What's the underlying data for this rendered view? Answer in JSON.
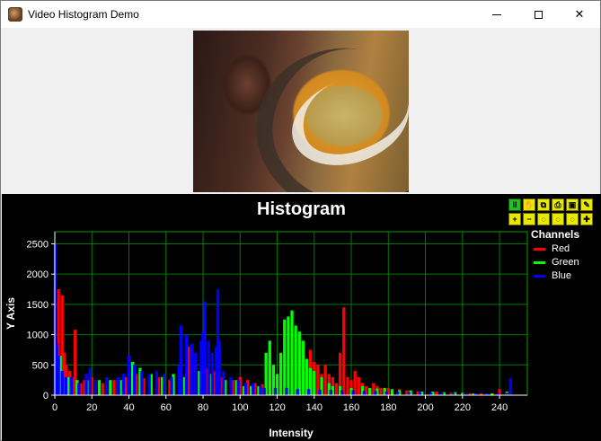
{
  "window": {
    "title": "Video Histogram Demo"
  },
  "chart_data": {
    "type": "bar",
    "title": "Histogram",
    "xlabel": "Intensity",
    "ylabel": "Y Axis",
    "xlim": [
      0,
      255
    ],
    "ylim": [
      0,
      2700
    ],
    "xticks": [
      0,
      20,
      40,
      60,
      80,
      100,
      120,
      140,
      160,
      180,
      200,
      220,
      240
    ],
    "yticks": [
      0,
      500,
      1000,
      1500,
      2000,
      2500
    ],
    "grid": true,
    "legend_title": "Channels",
    "legend_position": "right",
    "series": [
      {
        "name": "Red",
        "color": "#ff0000",
        "points": [
          [
            2,
            1750
          ],
          [
            4,
            1650
          ],
          [
            5,
            700
          ],
          [
            6,
            500
          ],
          [
            8,
            400
          ],
          [
            10,
            300
          ],
          [
            11,
            1080
          ],
          [
            14,
            200
          ],
          [
            16,
            250
          ],
          [
            20,
            300
          ],
          [
            26,
            200
          ],
          [
            32,
            250
          ],
          [
            38,
            300
          ],
          [
            44,
            350
          ],
          [
            48,
            280
          ],
          [
            56,
            300
          ],
          [
            62,
            250
          ],
          [
            68,
            600
          ],
          [
            72,
            800
          ],
          [
            74,
            700
          ],
          [
            76,
            500
          ],
          [
            82,
            450
          ],
          [
            86,
            400
          ],
          [
            90,
            300
          ],
          [
            96,
            250
          ],
          [
            100,
            300
          ],
          [
            104,
            250
          ],
          [
            108,
            200
          ],
          [
            112,
            180
          ],
          [
            116,
            200
          ],
          [
            120,
            150
          ],
          [
            132,
            250
          ],
          [
            134,
            800
          ],
          [
            136,
            600
          ],
          [
            138,
            750
          ],
          [
            140,
            550
          ],
          [
            142,
            500
          ],
          [
            144,
            350
          ],
          [
            146,
            500
          ],
          [
            148,
            350
          ],
          [
            150,
            300
          ],
          [
            152,
            200
          ],
          [
            154,
            700
          ],
          [
            156,
            1450
          ],
          [
            158,
            300
          ],
          [
            160,
            250
          ],
          [
            162,
            400
          ],
          [
            164,
            300
          ],
          [
            166,
            200
          ],
          [
            168,
            150
          ],
          [
            170,
            120
          ],
          [
            172,
            200
          ],
          [
            174,
            150
          ],
          [
            176,
            120
          ],
          [
            178,
            100
          ],
          [
            180,
            120
          ],
          [
            186,
            100
          ],
          [
            190,
            80
          ],
          [
            196,
            60
          ],
          [
            206,
            60
          ],
          [
            214,
            40
          ],
          [
            224,
            30
          ],
          [
            230,
            30
          ],
          [
            240,
            100
          ],
          [
            244,
            40
          ]
        ]
      },
      {
        "name": "Green",
        "color": "#00ff00",
        "points": [
          [
            3,
            650
          ],
          [
            7,
            300
          ],
          [
            12,
            250
          ],
          [
            18,
            250
          ],
          [
            24,
            250
          ],
          [
            30,
            250
          ],
          [
            36,
            250
          ],
          [
            42,
            550
          ],
          [
            46,
            450
          ],
          [
            52,
            350
          ],
          [
            58,
            300
          ],
          [
            64,
            350
          ],
          [
            70,
            300
          ],
          [
            78,
            400
          ],
          [
            84,
            350
          ],
          [
            92,
            250
          ],
          [
            98,
            250
          ],
          [
            102,
            150
          ],
          [
            106,
            150
          ],
          [
            110,
            150
          ],
          [
            114,
            700
          ],
          [
            116,
            900
          ],
          [
            118,
            500
          ],
          [
            120,
            350
          ],
          [
            122,
            700
          ],
          [
            124,
            1250
          ],
          [
            126,
            1300
          ],
          [
            128,
            1400
          ],
          [
            130,
            1150
          ],
          [
            132,
            1050
          ],
          [
            134,
            900
          ],
          [
            136,
            600
          ],
          [
            138,
            450
          ],
          [
            140,
            400
          ],
          [
            144,
            300
          ],
          [
            148,
            200
          ],
          [
            150,
            150
          ],
          [
            154,
            150
          ],
          [
            160,
            120
          ],
          [
            166,
            150
          ],
          [
            170,
            120
          ],
          [
            174,
            110
          ],
          [
            178,
            120
          ],
          [
            182,
            100
          ],
          [
            186,
            80
          ],
          [
            192,
            80
          ],
          [
            198,
            60
          ],
          [
            204,
            60
          ],
          [
            210,
            50
          ],
          [
            216,
            50
          ],
          [
            220,
            40
          ],
          [
            226,
            30
          ],
          [
            236,
            30
          ],
          [
            244,
            60
          ]
        ]
      },
      {
        "name": "Blue",
        "color": "#0000ff",
        "points": [
          [
            0,
            2500
          ],
          [
            1,
            850
          ],
          [
            2,
            650
          ],
          [
            4,
            400
          ],
          [
            6,
            300
          ],
          [
            9,
            300
          ],
          [
            13,
            200
          ],
          [
            17,
            350
          ],
          [
            19,
            450
          ],
          [
            22,
            250
          ],
          [
            28,
            300
          ],
          [
            34,
            300
          ],
          [
            37,
            350
          ],
          [
            40,
            650
          ],
          [
            43,
            500
          ],
          [
            47,
            400
          ],
          [
            51,
            350
          ],
          [
            55,
            400
          ],
          [
            59,
            350
          ],
          [
            63,
            300
          ],
          [
            67,
            500
          ],
          [
            68,
            1150
          ],
          [
            71,
            1000
          ],
          [
            74,
            850
          ],
          [
            76,
            700
          ],
          [
            79,
            900
          ],
          [
            80,
            1050
          ],
          [
            81,
            1550
          ],
          [
            83,
            900
          ],
          [
            85,
            700
          ],
          [
            87,
            800
          ],
          [
            88,
            1750
          ],
          [
            89,
            900
          ],
          [
            91,
            400
          ],
          [
            95,
            300
          ],
          [
            99,
            250
          ],
          [
            103,
            200
          ],
          [
            107,
            200
          ],
          [
            111,
            150
          ],
          [
            113,
            120
          ],
          [
            119,
            120
          ],
          [
            125,
            120
          ],
          [
            131,
            100
          ],
          [
            137,
            100
          ],
          [
            143,
            90
          ],
          [
            149,
            90
          ],
          [
            155,
            80
          ],
          [
            161,
            80
          ],
          [
            167,
            70
          ],
          [
            173,
            70
          ],
          [
            179,
            60
          ],
          [
            185,
            60
          ],
          [
            191,
            50
          ],
          [
            197,
            50
          ],
          [
            203,
            40
          ],
          [
            209,
            40
          ],
          [
            215,
            40
          ],
          [
            221,
            30
          ],
          [
            227,
            30
          ],
          [
            233,
            30
          ],
          [
            239,
            30
          ],
          [
            244,
            40
          ],
          [
            246,
            280
          ]
        ]
      }
    ]
  },
  "toolbar": {
    "buttons": [
      {
        "name": "pause-button",
        "glyph": "II"
      },
      {
        "name": "pan-button",
        "glyph": "✋"
      },
      {
        "name": "copy-button",
        "glyph": "⧉"
      },
      {
        "name": "print-button",
        "glyph": "⎙"
      },
      {
        "name": "save-button",
        "glyph": "▣"
      },
      {
        "name": "settings-button",
        "glyph": "✎"
      },
      {
        "name": "zoom-in-button",
        "glyph": "+"
      },
      {
        "name": "zoom-out-button",
        "glyph": "−"
      },
      {
        "name": "zoom-box-button",
        "glyph": "◌"
      },
      {
        "name": "zoom-reset-button",
        "glyph": "◌"
      },
      {
        "name": "zoom-fit-button",
        "glyph": "◌"
      },
      {
        "name": "axis-button",
        "glyph": "✚"
      }
    ]
  },
  "icons": {
    "app": "app-icon"
  }
}
